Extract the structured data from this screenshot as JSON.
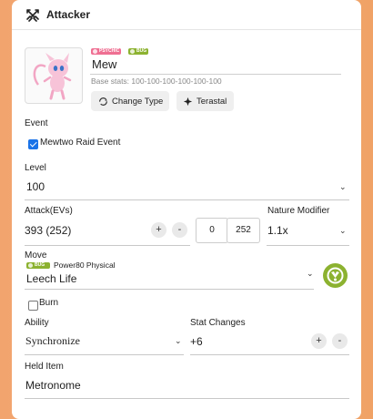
{
  "header": {
    "title": "Attacker",
    "icon": "swords-icon"
  },
  "pokemon": {
    "name": "Mew",
    "types": [
      {
        "label": "PSYCHIC",
        "color": "#ef6f92"
      },
      {
        "label": "BUG",
        "color": "#8cb230"
      }
    ],
    "base_stats": "Base stats: 100-100-100-100-100-100",
    "change_type_label": "Change Type",
    "terastal_label": "Terastal"
  },
  "event": {
    "label": "Event",
    "checkbox_label": "Mewtwo Raid Event",
    "checked": true
  },
  "level": {
    "label": "Level",
    "value": "100"
  },
  "attack": {
    "label": "Attack(EVs)",
    "value": "393 (252)",
    "plus": "+",
    "minus": "-",
    "iv": "0",
    "ev": "252"
  },
  "nature": {
    "label": "Nature Modifier",
    "value": "1.1x"
  },
  "move": {
    "label": "Move",
    "type_badge": "BUG",
    "type_color": "#8cb230",
    "power_text": "Power80 Physical",
    "value": "Leech Life"
  },
  "burn": {
    "label": "Burn",
    "checked": false
  },
  "ability": {
    "label": "Ability",
    "value": "Synchronize"
  },
  "stat_changes": {
    "label": "Stat Changes",
    "value": "+6",
    "plus": "+",
    "minus": "-"
  },
  "held_item": {
    "label": "Held Item",
    "value": "Metronome"
  }
}
